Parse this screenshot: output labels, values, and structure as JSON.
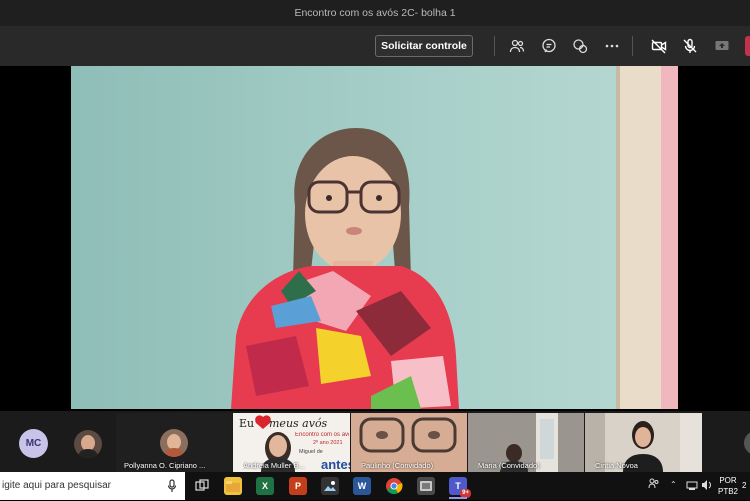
{
  "window": {
    "title": "Encontro com os avós 2C- bolha 1"
  },
  "toolbar": {
    "solicitar_label": "Solicitar controle",
    "icons": [
      "participants-icon",
      "chat-icon",
      "reactions-icon",
      "more-icon",
      "camera-off-icon",
      "mic-off-icon",
      "share-icon",
      "hang-up-icon"
    ]
  },
  "participants": {
    "mc_initials": "MC",
    "tiles": [
      {
        "name": "Pollyanna O. Cipriano ..."
      },
      {
        "name": "Andreia Muller B..."
      },
      {
        "name": "Paulinho (Convidado)"
      },
      {
        "name": "Maria (Convidado)"
      },
      {
        "name": "Cintia Novoa"
      }
    ],
    "poster": {
      "line1": "Eu",
      "line2": "meus avós",
      "line3": "Encontro com os avós",
      "line4": "2º ano 2021",
      "line5": "Miguel de",
      "line6": "antes"
    }
  },
  "taskbar": {
    "search_placeholder": "igite aqui para pesquisar",
    "apps": [
      "task-view",
      "file-explorer",
      "excel",
      "powerpoint",
      "photos",
      "word",
      "chrome",
      "app",
      "teams"
    ],
    "teams_badge": "9+",
    "lang_line1": "POR",
    "lang_line2": "PTB2",
    "clock_fragment": "2"
  },
  "colors": {
    "titlebar": "#1f1f1f",
    "toolbar": "#292929",
    "hangup": "#c4314b",
    "wall": "#9dc3bd"
  }
}
